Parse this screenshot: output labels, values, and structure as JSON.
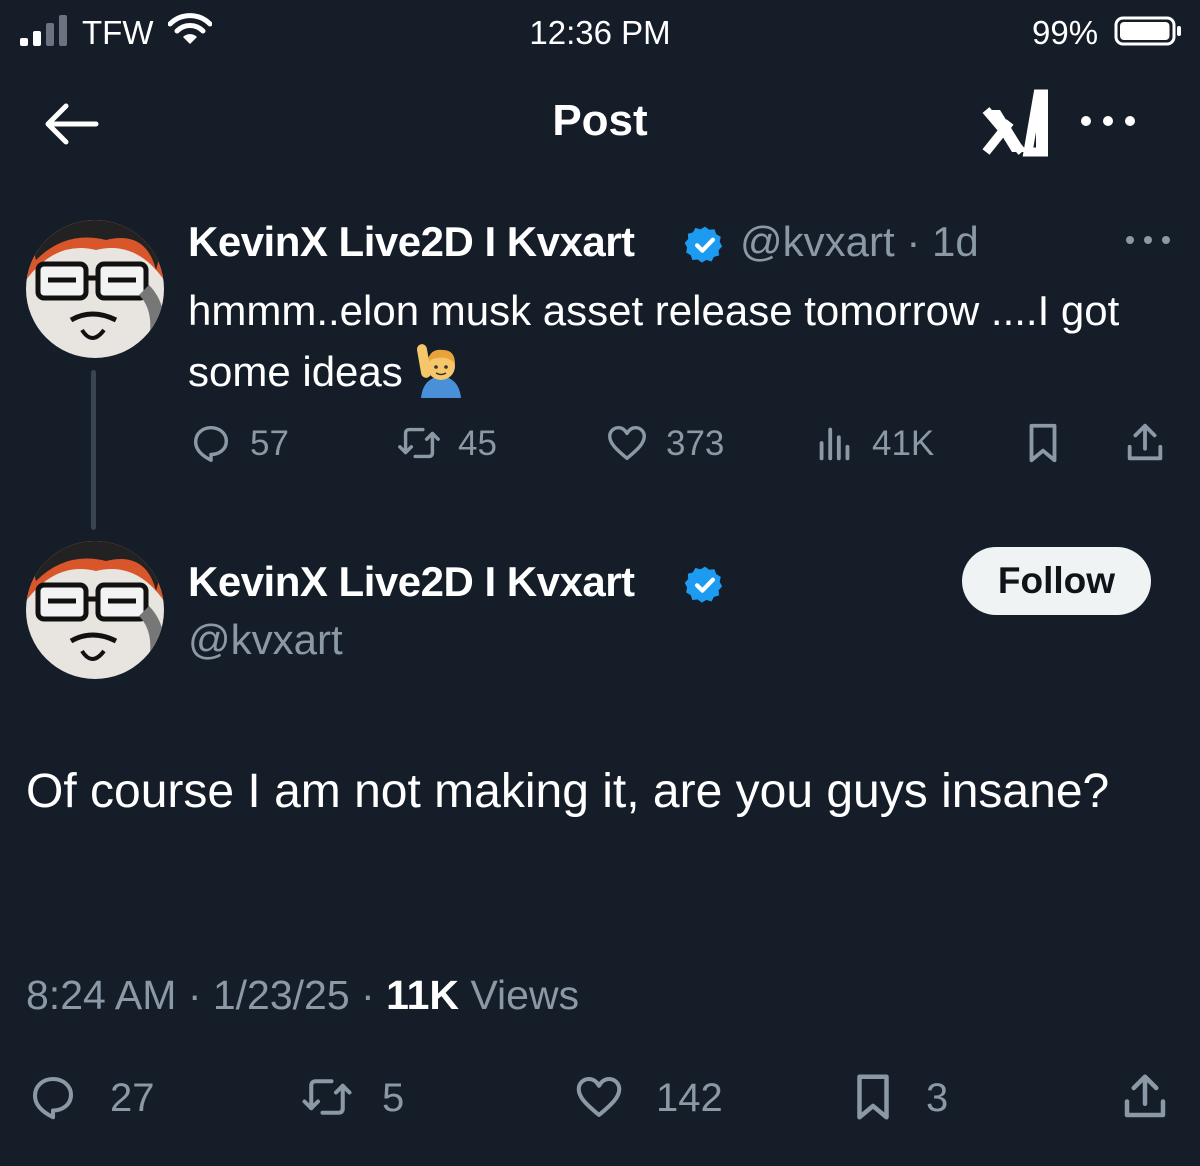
{
  "status_bar": {
    "carrier": "TFW",
    "time": "12:36 PM",
    "battery": "99%",
    "battery_level": 0.99
  },
  "nav": {
    "title": "Post"
  },
  "parent_tweet": {
    "display_name": "KevinX Live2D I Kvxart",
    "handle_time": "@kvxart · 1d",
    "text": "hmmm..elon musk asset release tomorrow ....I got some ideas",
    "emoji": "raising-hand-emoji",
    "replies": "57",
    "reposts": "45",
    "likes": "373",
    "views": "41K"
  },
  "main_tweet": {
    "display_name": "KevinX Live2D I Kvxart",
    "handle": "@kvxart",
    "follow_label": "Follow",
    "text": "Of course I am not making it, are you guys insane?",
    "timestamp": "8:24 AM · 1/23/25 · ",
    "view_count": "11K",
    "views_label": " Views",
    "replies": "27",
    "reposts": "5",
    "likes": "142",
    "bookmarks": "3"
  },
  "colors": {
    "background": "#151d28",
    "muted": "#8b98a5",
    "verified": "#1d9bf0"
  }
}
